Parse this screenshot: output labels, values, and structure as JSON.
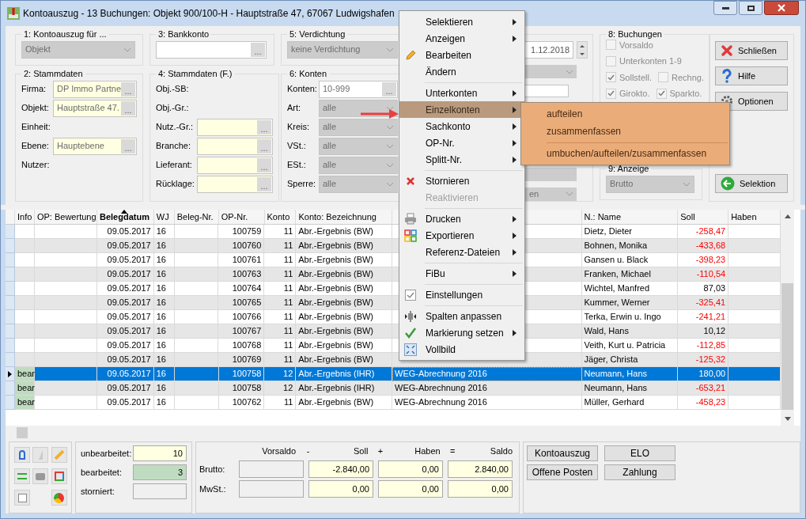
{
  "window": {
    "title": "Kontoauszug - 13 Buchungen:  Objekt 900/100-H - Hauptstraße 47, 67067 Ludwigshafen"
  },
  "group_1": {
    "label": "1: Kontoauszug für ...",
    "value": "Objekt"
  },
  "group_3": {
    "label": "3: Bankkonto",
    "button": "..."
  },
  "group_5": {
    "label": "5: Verdichtung",
    "value": "keine Verdichtung"
  },
  "group_2": {
    "label": "2: Stammdaten",
    "rows": [
      {
        "label": "Firma:",
        "kind": "field",
        "value": "DP Immo Partne",
        "button": "..."
      },
      {
        "label": "Objekt:",
        "kind": "field",
        "value": "Hauptstraße 47.",
        "button": "..."
      },
      {
        "label": "Einheit:",
        "kind": "label"
      },
      {
        "label": "Ebene:",
        "kind": "field",
        "value": "Hauptebene",
        "button": "..."
      },
      {
        "label": "Nutzer:",
        "kind": "label"
      }
    ]
  },
  "group_4": {
    "label": "4: Stammdaten (F.)",
    "rows": [
      {
        "label": "Obj.-SB:",
        "kind": "label"
      },
      {
        "label": "Obj.-Gr.:",
        "kind": "label"
      },
      {
        "label": "Nutz.-Gr.:",
        "kind": "field",
        "value": "",
        "button": "..."
      },
      {
        "label": "Branche:",
        "kind": "field",
        "value": "",
        "button": "..."
      },
      {
        "label": "Lieferant:",
        "kind": "field",
        "value": "",
        "button": "..."
      },
      {
        "label": "Rücklage:",
        "kind": "field",
        "value": "",
        "button": "..."
      }
    ]
  },
  "group_6": {
    "label": "6: Konten",
    "rows": [
      {
        "label": "Konten:",
        "kind": "text",
        "value": "10-999",
        "button": "..."
      },
      {
        "label": "Art:",
        "kind": "select",
        "value": "alle"
      },
      {
        "label": "Kreis:",
        "kind": "select",
        "value": "alle"
      },
      {
        "label": "VSt.:",
        "kind": "select",
        "value": "alle"
      },
      {
        "label": "ESt.:",
        "kind": "select",
        "value": "alle"
      },
      {
        "label": "Sperre:",
        "kind": "select",
        "value": "alle"
      }
    ]
  },
  "group_7": {
    "date": "1.12.2018",
    "select": "en"
  },
  "group_8": {
    "label": "8: Buchungen",
    "checkboxes": [
      {
        "label": "Vorsaldo",
        "checked": false
      },
      {
        "label": "Unterkonten 1-9",
        "checked": false
      },
      {
        "label": "Sollstell.",
        "checked": true
      },
      {
        "label": "Rechng.",
        "checked": false
      },
      {
        "label": "Girokto.",
        "checked": true
      },
      {
        "label": "Sparkto.",
        "checked": true
      }
    ]
  },
  "group_9": {
    "label": "9: Anzeige",
    "value": "Brutto"
  },
  "side_buttons": [
    "Schließen",
    "Hilfe",
    "Optionen",
    "Selektion"
  ],
  "table": {
    "columns": [
      {
        "label": "Info",
        "sorted": false
      },
      {
        "label": "OP: Bewertung",
        "sorted": false
      },
      {
        "label": "Belegdatum",
        "sorted": true
      },
      {
        "label": "WJ",
        "sorted": false
      },
      {
        "label": "Beleg-Nr.",
        "sorted": false
      },
      {
        "label": "OP-Nr.",
        "sorted": false
      },
      {
        "label": "Konto",
        "sorted": false
      },
      {
        "label": "Konto: Bezeichnung",
        "sorted": false
      },
      {
        "label": "N.: Name",
        "sorted": false
      },
      {
        "label": "Soll",
        "sorted": false
      },
      {
        "label": "Haben",
        "sorted": false
      }
    ],
    "rows": [
      {
        "selected": false,
        "info": "",
        "date": "09.05.2017",
        "wj": "16",
        "op": "100759",
        "konto": "11",
        "bez": "Abr.-Ergebnis (BW)",
        "column_9": "",
        "name": "Dietz, Dieter",
        "soll": "-258,47",
        "negative": true
      },
      {
        "selected": false,
        "info": "",
        "date": "09.05.2017",
        "wj": "16",
        "op": "100760",
        "konto": "11",
        "bez": "Abr.-Ergebnis (BW)",
        "column_9": "",
        "name": "Bohnen, Monika",
        "soll": "-433,68",
        "negative": true
      },
      {
        "selected": false,
        "info": "",
        "date": "09.05.2017",
        "wj": "16",
        "op": "100761",
        "konto": "11",
        "bez": "Abr.-Ergebnis (BW)",
        "column_9": "",
        "name": "Gansen u. Black",
        "soll": "-398,23",
        "negative": true
      },
      {
        "selected": false,
        "info": "",
        "date": "09.05.2017",
        "wj": "16",
        "op": "100763",
        "konto": "11",
        "bez": "Abr.-Ergebnis (BW)",
        "column_9": "",
        "name": "Franken, Michael",
        "soll": "-110,54",
        "negative": true
      },
      {
        "selected": false,
        "info": "",
        "date": "09.05.2017",
        "wj": "16",
        "op": "100764",
        "konto": "11",
        "bez": "Abr.-Ergebnis (BW)",
        "column_9": "",
        "name": "Wichtel, Manfred",
        "soll": "87,03",
        "negative": false
      },
      {
        "selected": false,
        "info": "",
        "date": "09.05.2017",
        "wj": "16",
        "op": "100765",
        "konto": "11",
        "bez": "Abr.-Ergebnis (BW)",
        "column_9": "",
        "name": "Kummer, Werner",
        "soll": "-325,41",
        "negative": true
      },
      {
        "selected": false,
        "info": "",
        "date": "09.05.2017",
        "wj": "16",
        "op": "100766",
        "konto": "11",
        "bez": "Abr.-Ergebnis (BW)",
        "column_9": "",
        "name": "Terka, Erwin u. Ingo",
        "soll": "-241,21",
        "negative": true
      },
      {
        "selected": false,
        "info": "",
        "date": "09.05.2017",
        "wj": "16",
        "op": "100767",
        "konto": "11",
        "bez": "Abr.-Ergebnis (BW)",
        "column_9": "",
        "name": "Wald, Hans",
        "soll": "10,12",
        "negative": false
      },
      {
        "selected": false,
        "info": "",
        "date": "09.05.2017",
        "wj": "16",
        "op": "100768",
        "konto": "11",
        "bez": "Abr.-Ergebnis (BW)",
        "column_9": "",
        "name": "Veith, Kurt u. Patricia",
        "soll": "-112,85",
        "negative": true
      },
      {
        "selected": false,
        "info": "",
        "date": "09.05.2017",
        "wj": "16",
        "op": "100769",
        "konto": "11",
        "bez": "Abr.-Ergebnis (BW)",
        "column_9": "",
        "name": "Jäger, Christa",
        "soll": "-125,32",
        "negative": true
      },
      {
        "selected": true,
        "info": "bear",
        "date": "09.05.2017",
        "wj": "16",
        "op": "100758",
        "konto": "12",
        "bez": "Abr.-Ergebnis (IHR)",
        "column_9": "WEG-Abrechnung 2016",
        "name": "Neumann, Hans",
        "soll": "180,00",
        "negative": false
      },
      {
        "selected": false,
        "info": "bear",
        "date": "09.05.2017",
        "wj": "16",
        "op": "100758",
        "konto": "12",
        "bez": "Abr.-Ergebnis (IHR)",
        "column_9": "WEG-Abrechnung 2016",
        "name": "Neumann, Hans",
        "soll": "-653,21",
        "negative": true
      },
      {
        "selected": false,
        "info": "bear",
        "date": "09.05.2017",
        "wj": "16",
        "op": "100762",
        "konto": "11",
        "bez": "Abr.-Ergebnis (BW)",
        "column_9": "WEG-Abrechnung 2016",
        "name": "Müller, Gerhard",
        "soll": "-458,23",
        "negative": true
      }
    ]
  },
  "counts": [
    {
      "label": "unbearbeitet:",
      "value": "10",
      "kind": "plain"
    },
    {
      "label": "bearbeitet:",
      "value": "3",
      "kind": "done"
    },
    {
      "label": "storniert:",
      "kind": "empty"
    }
  ],
  "totals": {
    "headers": [
      "Vorsaldo",
      "-",
      "Soll",
      "+",
      "Haben",
      "=",
      "Saldo"
    ],
    "rows": [
      {
        "label": "Brutto:",
        "vorsaldo": "",
        "soll": "-2.840,00",
        "haben": "0,00",
        "saldo": "2.840,00"
      },
      {
        "label": "MwSt.:",
        "vorsaldo": "",
        "soll": "0,00",
        "haben": "0,00",
        "saldo": "0,00"
      }
    ]
  },
  "bottom_buttons": [
    "Kontoauszug",
    "ELO",
    "Offene Posten",
    "Zahlung"
  ],
  "context_menu": {
    "items": [
      {
        "kind": "item",
        "label": "Selektieren",
        "submenu": true,
        "disabled": false,
        "selected": false
      },
      {
        "kind": "item",
        "label": "Anzeigen",
        "submenu": true,
        "disabled": false,
        "selected": false
      },
      {
        "kind": "item",
        "label": "Bearbeiten",
        "submenu": false,
        "disabled": false,
        "selected": false
      },
      {
        "kind": "item",
        "label": "Ändern",
        "submenu": false,
        "disabled": false,
        "selected": false
      },
      {
        "kind": "separator"
      },
      {
        "kind": "item",
        "label": "Unterkonten",
        "submenu": true,
        "disabled": false,
        "selected": false
      },
      {
        "kind": "item",
        "label": "Einzelkonten",
        "submenu": true,
        "disabled": false,
        "selected": true
      },
      {
        "kind": "item",
        "label": "Sachkonto",
        "submenu": true,
        "disabled": false,
        "selected": false
      },
      {
        "kind": "item",
        "label": "OP-Nr.",
        "submenu": true,
        "disabled": false,
        "selected": false
      },
      {
        "kind": "item",
        "label": "Splitt-Nr.",
        "submenu": true,
        "disabled": false,
        "selected": false
      },
      {
        "kind": "separator"
      },
      {
        "kind": "item",
        "label": "Stornieren",
        "submenu": false,
        "disabled": false,
        "selected": false
      },
      {
        "kind": "item",
        "label": "Reaktivieren",
        "submenu": false,
        "disabled": true,
        "selected": false
      },
      {
        "kind": "separator"
      },
      {
        "kind": "item",
        "label": "Drucken",
        "submenu": true,
        "disabled": false,
        "selected": false
      },
      {
        "kind": "item",
        "label": "Exportieren",
        "submenu": true,
        "disabled": false,
        "selected": false
      },
      {
        "kind": "item",
        "label": "Referenz-Dateien",
        "submenu": true,
        "disabled": false,
        "selected": false
      },
      {
        "kind": "separator"
      },
      {
        "kind": "item",
        "label": "FiBu",
        "submenu": true,
        "disabled": false,
        "selected": false
      },
      {
        "kind": "separator"
      },
      {
        "kind": "item",
        "label": "Einstellungen",
        "submenu": false,
        "disabled": false,
        "selected": false
      },
      {
        "kind": "separator"
      },
      {
        "kind": "item",
        "label": "Spalten anpassen",
        "submenu": false,
        "disabled": false,
        "selected": false
      },
      {
        "kind": "item",
        "label": "Markierung setzen",
        "submenu": true,
        "disabled": false,
        "selected": false
      },
      {
        "kind": "item",
        "label": "Vollbild",
        "submenu": false,
        "disabled": false,
        "selected": false
      }
    ],
    "submenu": [
      {
        "kind": "item",
        "label": "aufteilen"
      },
      {
        "kind": "item",
        "label": "zusammenfassen"
      },
      {
        "kind": "separator"
      },
      {
        "kind": "item",
        "label": "umbuchen/aufteilen/zusammenfassen"
      }
    ]
  }
}
